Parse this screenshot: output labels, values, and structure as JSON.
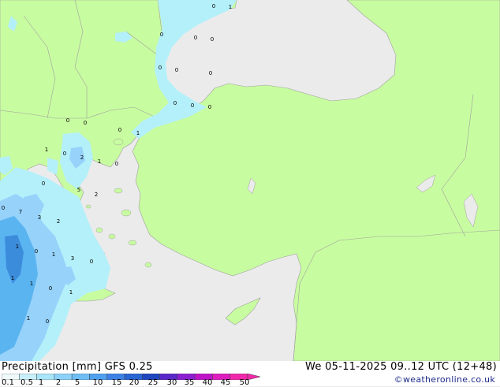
{
  "map": {
    "colors": {
      "sea": "#ebebeb",
      "land": "#c8fca0",
      "border": "#a0a0a0",
      "precip_light": "#b4f0fa",
      "precip_mid": "#96d2fa",
      "precip_heavy": "#5ab4f0",
      "precip_strong": "#3c8cdc"
    },
    "value_labels": [
      "0",
      "1",
      "0",
      "0",
      "0",
      "0",
      "0",
      "0",
      "0",
      "0",
      "0",
      "0",
      "1",
      "0",
      "0",
      "1",
      "0",
      "2",
      "1",
      "0",
      "0",
      "5",
      "2",
      "0",
      "7",
      "3",
      "2",
      "1",
      "0",
      "1",
      "3",
      "0",
      "1",
      "1",
      "0",
      "1",
      "1",
      "0"
    ]
  },
  "footer": {
    "title_left": "Precipitation [mm]  GFS 0.25",
    "title_right": "We 05-11-2025 09..12 UTC (12+48)",
    "credit": "©weatheronline.co.uk",
    "scale_ticks": [
      "0.1",
      "0.5",
      "1",
      "2",
      "5",
      "10",
      "15",
      "20",
      "25",
      "30",
      "35",
      "40",
      "45",
      "50"
    ],
    "scale_colors": [
      "#f0fafa",
      "#c8f0fa",
      "#aae6fa",
      "#8cd2fa",
      "#6ebef5",
      "#50a0f0",
      "#3c82e6",
      "#2864d2",
      "#1e46be",
      "#5a28c8",
      "#8c1ed2",
      "#be14c8",
      "#dc1ebe",
      "#f028aa"
    ]
  }
}
